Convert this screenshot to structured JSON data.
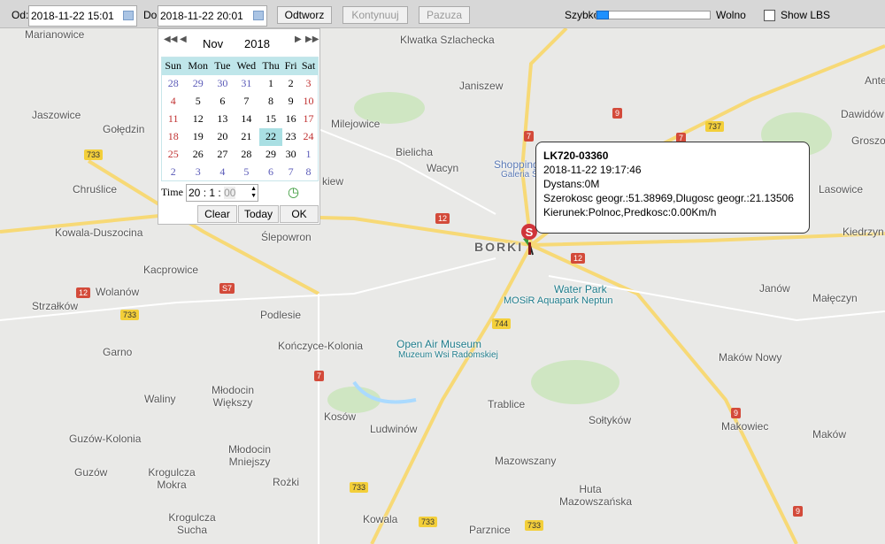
{
  "toolbar": {
    "from_label": "Od:",
    "from_value": "2018-11-22 15:01",
    "to_label": "Do",
    "to_value": "2018-11-22 20:01",
    "play": "Odtworz",
    "continue": "Kontynuuj",
    "pause": "Pazuza",
    "fast": "Szybko",
    "slow": "Wolno",
    "speed_fraction": 0.0,
    "show_lbs": "Show LBS",
    "show_lbs_checked": false
  },
  "calendar": {
    "month": "Nov",
    "year": "2018",
    "weekdays": [
      "Sun",
      "Mon",
      "Tue",
      "Wed",
      "Thu",
      "Fri",
      "Sat"
    ],
    "weeks": [
      [
        "28",
        "29",
        "30",
        "31",
        "1",
        "2",
        "3"
      ],
      [
        "4",
        "5",
        "6",
        "7",
        "8",
        "9",
        "10"
      ],
      [
        "11",
        "12",
        "13",
        "14",
        "15",
        "16",
        "17"
      ],
      [
        "18",
        "19",
        "20",
        "21",
        "22",
        "23",
        "24"
      ],
      [
        "25",
        "26",
        "27",
        "28",
        "29",
        "30",
        "1"
      ],
      [
        "2",
        "3",
        "4",
        "5",
        "6",
        "7",
        "8"
      ]
    ],
    "selected": "22",
    "time_label": "Time",
    "hour": "20",
    "minute": "1",
    "second": "00",
    "clear": "Clear",
    "today": "Today",
    "ok": "OK"
  },
  "popup": {
    "title": "LK720-03360",
    "time": "2018-11-22 19:17:46",
    "distance": "Dystans:0M",
    "coords": "Szerokosc geogr.:51.38969,Dlugosc geogr.:21.13506",
    "heading": "Kierunek:Polnoc,Predkosc:0.00Km/h"
  },
  "marker": {
    "letter": "S"
  },
  "map": {
    "labels": [
      "Marianowice",
      "Klwatka Szlachecka",
      "Janiszew",
      "Jaszowice",
      "Gołędzin",
      "Milejowice",
      "Bielicha",
      "Wacyn",
      "Chruślice",
      "Kowala-Duszocina",
      "Ślepowron",
      "Kacprowice",
      "Wolanów",
      "Strzałków",
      "Podlesie",
      "Garno",
      "Kończyce-Kolonia",
      "Open Air Museum",
      "Muzeum Wsi Radomskiej",
      "Młodocin Większy",
      "Waliny",
      "Kosów",
      "Ludwinów",
      "Trablice",
      "Guzów-Kolonia",
      "Guzów",
      "Krogulcza Mokra",
      "Młodocin Mniejszy",
      "Rożki",
      "Mazowszany",
      "Huta Mazowszańska",
      "Krogulcza Sucha",
      "Kowala",
      "Parznice",
      "BORKI",
      "Shopping",
      "Galeria Słoneczna",
      "Water Park",
      "MOSiR Aquapark Neptun",
      "Janów",
      "Małęczyn",
      "Maków Nowy",
      "Sołtyków",
      "Makowiec",
      "Maków",
      "Lasowice",
      "Kiedrzyn",
      "Dawidów",
      "Groszowice",
      "Ante",
      "kiew"
    ],
    "shields": [
      "733",
      "12",
      "S7",
      "733",
      "7",
      "9",
      "737",
      "7",
      "12",
      "12",
      "744",
      "7",
      "9",
      "733",
      "733",
      "9",
      "733"
    ]
  }
}
